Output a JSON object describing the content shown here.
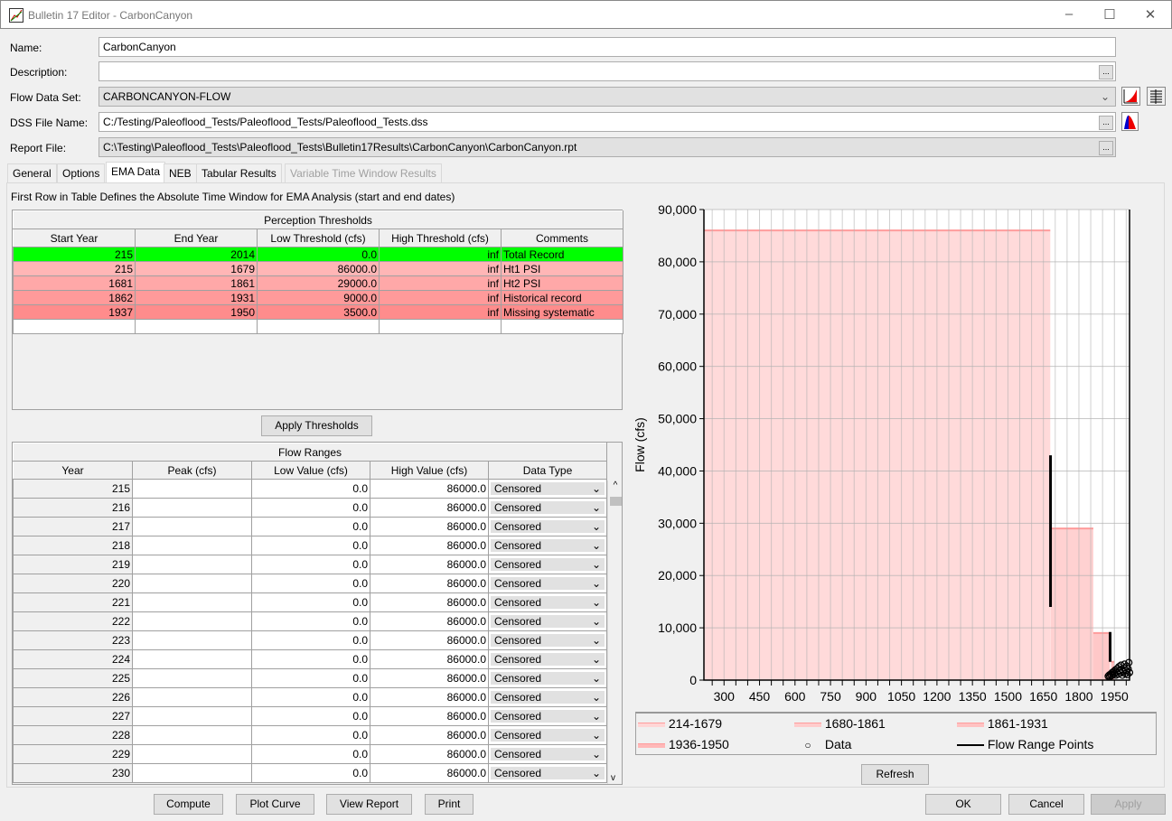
{
  "window": {
    "title": "Bulletin 17 Editor - CarbonCanyon",
    "minimize": "–",
    "maximize": "☐",
    "close": "✕"
  },
  "form": {
    "name_label": "Name:",
    "name_value": "CarbonCanyon",
    "description_label": "Description:",
    "description_value": "",
    "flow_label": "Flow Data Set:",
    "flow_value": "CARBONCANYON-FLOW",
    "dss_label": "DSS File Name:",
    "dss_value": "C:/Testing/Paleoflood_Tests/Paleoflood_Tests/Paleoflood_Tests.dss",
    "report_label": "Report File:",
    "report_value": "C:\\Testing\\Paleoflood_Tests\\Paleoflood_Tests\\Bulletin17Results\\CarbonCanyon\\CarbonCanyon.rpt",
    "browse": "..."
  },
  "tabs": [
    "General",
    "Options",
    "EMA Data",
    "NEB",
    "Tabular Results",
    "Variable Time Window Results"
  ],
  "ema": {
    "note": "First Row in Table Defines the Absolute Time Window for EMA Analysis (start and end dates)",
    "thresholds_title": "Perception Thresholds",
    "threshold_columns": [
      "Start Year",
      "End Year",
      "Low Threshold (cfs)",
      "High Threshold (cfs)",
      "Comments"
    ],
    "thresholds": [
      {
        "start": "215",
        "end": "2014",
        "low": "0.0",
        "high": "inf",
        "comment": "Total Record",
        "color": "#00ff00"
      },
      {
        "start": "215",
        "end": "1679",
        "low": "86000.0",
        "high": "inf",
        "comment": "Ht1 PSI",
        "color": "#ffb6b6"
      },
      {
        "start": "1681",
        "end": "1861",
        "low": "29000.0",
        "high": "inf",
        "comment": "Ht2 PSI",
        "color": "#ffa8a8"
      },
      {
        "start": "1862",
        "end": "1931",
        "low": "9000.0",
        "high": "inf",
        "comment": "Historical record",
        "color": "#ff9a9a"
      },
      {
        "start": "1937",
        "end": "1950",
        "low": "3500.0",
        "high": "inf",
        "comment": "Missing systematic",
        "color": "#ff8c8c"
      }
    ],
    "apply_thresholds": "Apply Thresholds",
    "flow_title": "Flow Ranges",
    "flow_columns": [
      "Year",
      "Peak (cfs)",
      "Low Value (cfs)",
      "High Value (cfs)",
      "Data Type"
    ],
    "flow_rows": [
      {
        "year": "215",
        "peak": "",
        "low": "0.0",
        "high": "86000.0",
        "type": "Censored"
      },
      {
        "year": "216",
        "peak": "",
        "low": "0.0",
        "high": "86000.0",
        "type": "Censored"
      },
      {
        "year": "217",
        "peak": "",
        "low": "0.0",
        "high": "86000.0",
        "type": "Censored"
      },
      {
        "year": "218",
        "peak": "",
        "low": "0.0",
        "high": "86000.0",
        "type": "Censored"
      },
      {
        "year": "219",
        "peak": "",
        "low": "0.0",
        "high": "86000.0",
        "type": "Censored"
      },
      {
        "year": "220",
        "peak": "",
        "low": "0.0",
        "high": "86000.0",
        "type": "Censored"
      },
      {
        "year": "221",
        "peak": "",
        "low": "0.0",
        "high": "86000.0",
        "type": "Censored"
      },
      {
        "year": "222",
        "peak": "",
        "low": "0.0",
        "high": "86000.0",
        "type": "Censored"
      },
      {
        "year": "223",
        "peak": "",
        "low": "0.0",
        "high": "86000.0",
        "type": "Censored"
      },
      {
        "year": "224",
        "peak": "",
        "low": "0.0",
        "high": "86000.0",
        "type": "Censored"
      },
      {
        "year": "225",
        "peak": "",
        "low": "0.0",
        "high": "86000.0",
        "type": "Censored"
      },
      {
        "year": "226",
        "peak": "",
        "low": "0.0",
        "high": "86000.0",
        "type": "Censored"
      },
      {
        "year": "227",
        "peak": "",
        "low": "0.0",
        "high": "86000.0",
        "type": "Censored"
      },
      {
        "year": "228",
        "peak": "",
        "low": "0.0",
        "high": "86000.0",
        "type": "Censored"
      },
      {
        "year": "229",
        "peak": "",
        "low": "0.0",
        "high": "86000.0",
        "type": "Censored"
      },
      {
        "year": "230",
        "peak": "",
        "low": "0.0",
        "high": "86000.0",
        "type": "Censored"
      }
    ],
    "refresh": "Refresh"
  },
  "buttons": {
    "compute": "Compute",
    "plot_curve": "Plot Curve",
    "view_report": "View Report",
    "print": "Print",
    "ok": "OK",
    "cancel": "Cancel",
    "apply": "Apply"
  },
  "chart_data": {
    "type": "area",
    "ylabel": "Flow (cfs)",
    "xlabel": "",
    "xlim": [
      215,
      2014
    ],
    "ylim": [
      0,
      90000
    ],
    "xticks": [
      300,
      450,
      600,
      750,
      900,
      1050,
      1200,
      1350,
      1500,
      1650,
      1800,
      1950
    ],
    "yticks": [
      0,
      10000,
      20000,
      30000,
      40000,
      50000,
      60000,
      70000,
      80000,
      90000
    ],
    "ytick_labels": [
      "0",
      "10,000",
      "20,000",
      "30,000",
      "40,000",
      "50,000",
      "60,000",
      "70,000",
      "80,000",
      "90,000"
    ],
    "grid": true,
    "legend_placement": "bottom",
    "thresholds": [
      {
        "name": "214-1679",
        "start": 214,
        "end": 1679,
        "value": 86000,
        "color": "#ffd6d6"
      },
      {
        "name": "1680-1861",
        "start": 1680,
        "end": 1861,
        "value": 29000,
        "color": "#ffcccc"
      },
      {
        "name": "1861-1931",
        "start": 1861,
        "end": 1931,
        "value": 9000,
        "color": "#ffc2c2"
      },
      {
        "name": "1936-1950",
        "start": 1936,
        "end": 1950,
        "value": 3500,
        "color": "#ffb8b8"
      }
    ],
    "flow_range_points": {
      "name": "Flow Range Points",
      "color": "#000000",
      "ranges": [
        {
          "year": 1680,
          "low": 14000,
          "high": 43000
        },
        {
          "year": 1932,
          "low": 3500,
          "high": 9200
        }
      ]
    },
    "data": {
      "name": "Data",
      "points": [
        [
          1924,
          400
        ],
        [
          1928,
          600
        ],
        [
          1931,
          300
        ],
        [
          1934,
          800
        ],
        [
          1938,
          500
        ],
        [
          1941,
          1100
        ],
        [
          1944,
          700
        ],
        [
          1947,
          1300
        ],
        [
          1951,
          900
        ],
        [
          1954,
          1600
        ],
        [
          1957,
          600
        ],
        [
          1960,
          1200
        ],
        [
          1963,
          1900
        ],
        [
          1966,
          800
        ],
        [
          1969,
          2200
        ],
        [
          1972,
          1400
        ],
        [
          1975,
          1000
        ],
        [
          1978,
          2500
        ],
        [
          1981,
          1700
        ],
        [
          1984,
          600
        ],
        [
          1987,
          1300
        ],
        [
          1990,
          2000
        ],
        [
          1993,
          2700
        ],
        [
          1996,
          900
        ],
        [
          1999,
          1500
        ],
        [
          2002,
          2300
        ],
        [
          2005,
          700
        ],
        [
          2008,
          1800
        ],
        [
          2011,
          3000
        ],
        [
          2014,
          1100
        ]
      ]
    }
  }
}
